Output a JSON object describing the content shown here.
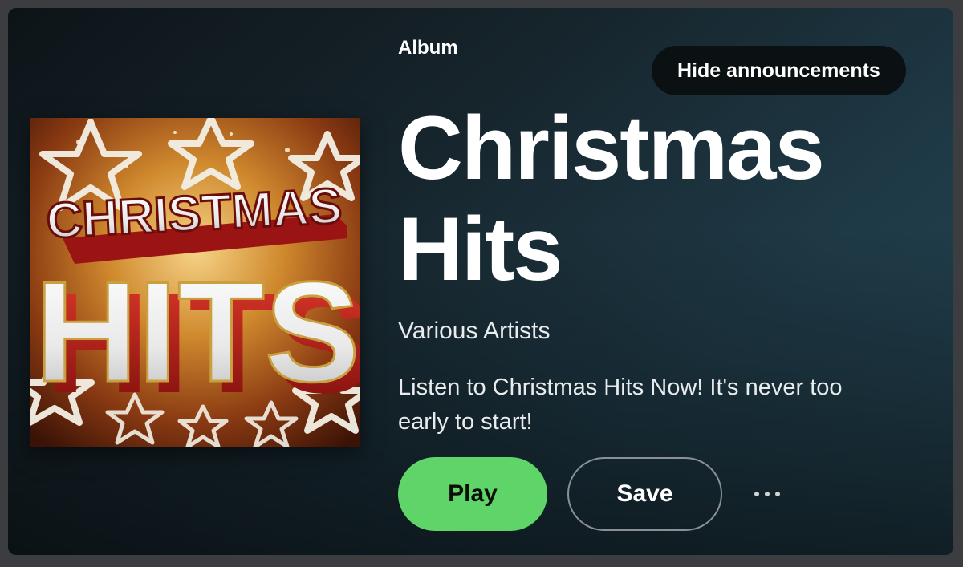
{
  "album": {
    "type_label": "Album",
    "title_line1": "Christmas",
    "title_line2": "Hits",
    "artist": "Various Artists",
    "description": "Listen to Christmas Hits Now! It's never too early to start!",
    "cover_art": {
      "text_top": "CHRISTMAS",
      "text_bottom": "HITS"
    }
  },
  "actions": {
    "hide_announcements_label": "Hide announcements",
    "play_label": "Play",
    "save_label": "Save",
    "more_icon": "more-options-icon"
  },
  "colors": {
    "play_accent": "#5fd468",
    "background_dark": "#0d1418",
    "background_teal": "#244452"
  }
}
